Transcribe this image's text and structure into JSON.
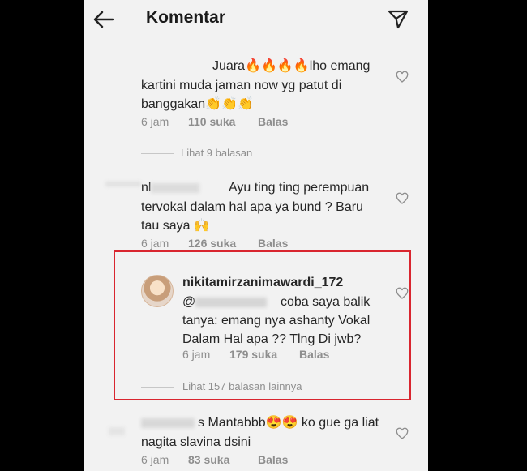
{
  "header": {
    "title": "Komentar"
  },
  "comments": [
    {
      "line1": "Juara🔥🔥🔥🔥lho emang",
      "line2": "kartini muda jaman now yg patut di",
      "line3": "banggakan👏👏👏",
      "time": "6 jam",
      "likes": "110 suka",
      "reply": "Balas",
      "view_replies": "Lihat 9 balasan"
    },
    {
      "username_visible": "nl",
      "line1": "Ayu ting ting perempuan",
      "line2": "tervokal dalam hal apa ya bund ? Baru",
      "line3": "tau saya 🙌",
      "time": "6 jam",
      "likes": "126 suka",
      "reply": "Balas"
    },
    {
      "username": "nikitamirzanimawardi_172",
      "mention": "@",
      "line1": "coba saya balik",
      "line2": "tanya: emang nya ashanty Vokal",
      "line3": "Dalam Hal apa ?? Tlng Di jwb?",
      "time": "6 jam",
      "likes": "179 suka",
      "reply": "Balas",
      "view_replies": "Lihat 157 balasan lainnya"
    },
    {
      "line1": "s Mantabbb😍😍 ko gue ga liat",
      "line2": "nagita slavina dsini",
      "time": "6 jam",
      "likes": "83 suka",
      "reply": "Balas"
    }
  ],
  "colors": {
    "highlight": "#d9262f",
    "text": "#262626",
    "muted": "#8e8e8e"
  }
}
